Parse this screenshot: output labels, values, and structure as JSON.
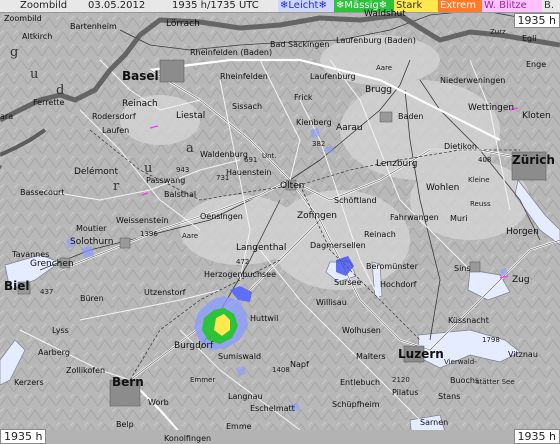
{
  "topbar": {
    "mode": "Zoombild",
    "date": "03.05.2012",
    "time": "1935 h/1735 UTC"
  },
  "legend": [
    {
      "label": "Leicht",
      "icon": "snowflake-icon",
      "glyph": "❄",
      "bg": "#cfd6ff",
      "color": "#1f2bd6"
    },
    {
      "label": "Mässig",
      "icon": "snowflake-icon",
      "glyph": "❄",
      "bg": "#2cc23a",
      "color": "#ffffff"
    },
    {
      "label": "Stark",
      "icon": "",
      "glyph": "",
      "bg": "#ffe94d",
      "color": "#333333"
    },
    {
      "label": "Extrem",
      "icon": "",
      "glyph": "",
      "bg": "#ff7a2a",
      "color": "#ffffff"
    },
    {
      "label": "W. Blitze",
      "icon": "",
      "glyph": "",
      "bg": "#ffc2ff",
      "color": "#a020a0"
    },
    {
      "label": "B.",
      "icon": "",
      "glyph": "",
      "bg": "#e8e8e8",
      "color": "#333333"
    }
  ],
  "time_boxes": {
    "top_right": "1935 h",
    "bottom_left": "1935 h",
    "bottom_right": "1935 h"
  },
  "colors": {
    "map_base": "#b9b9b9",
    "road": "#ffffff",
    "border": "#5c5c5c",
    "water": "#e8f0ff",
    "precip_light": "#8a9bff",
    "precip_moderate": "#2cc23a",
    "precip_heavy": "#ffe94d",
    "lightning": "#ff33ff"
  },
  "places": [
    {
      "name": "Zoombild"
    },
    {
      "name": "Altkirch"
    },
    {
      "name": "Bartenheim"
    },
    {
      "name": "Lörrach"
    },
    {
      "name": "Rheinfelden (Baden)"
    },
    {
      "name": "Laufenburg (Baden)"
    },
    {
      "name": "Bad Säckingen"
    },
    {
      "name": "Waldshut"
    },
    {
      "name": "Basel"
    },
    {
      "name": "Rheinfelden"
    },
    {
      "name": "Laufenburg"
    },
    {
      "name": "Frick"
    },
    {
      "name": "Brugg"
    },
    {
      "name": "Baden"
    },
    {
      "name": "Wettingen"
    },
    {
      "name": "Niederweningen"
    },
    {
      "name": "Kloten"
    },
    {
      "name": "Reinach"
    },
    {
      "name": "Rodersdorf"
    },
    {
      "name": "Ferrette"
    },
    {
      "name": "Liestal"
    },
    {
      "name": "Sissach"
    },
    {
      "name": "Kienberg"
    },
    {
      "name": "Aarau"
    },
    {
      "name": "Dietikon"
    },
    {
      "name": "Zürich"
    },
    {
      "name": "Laufen"
    },
    {
      "name": "Waldenburg"
    },
    {
      "name": "Lenzburg"
    },
    {
      "name": "Delémont"
    },
    {
      "name": "Hauenstein"
    },
    {
      "name": "Olten"
    },
    {
      "name": "Wohlen"
    },
    {
      "name": "Bassecourt"
    },
    {
      "name": "Passwang"
    },
    {
      "name": "Balsthal"
    },
    {
      "name": "Schöftland"
    },
    {
      "name": "Zofingen"
    },
    {
      "name": "Fahrwangen"
    },
    {
      "name": "Muri"
    },
    {
      "name": "Oensingen"
    },
    {
      "name": "Weissenstein"
    },
    {
      "name": "Moutier"
    },
    {
      "name": "Reinach"
    },
    {
      "name": "Horgen"
    },
    {
      "name": "Solothurn"
    },
    {
      "name": "Langenthal"
    },
    {
      "name": "Dagmersellen"
    },
    {
      "name": "Beromünster"
    },
    {
      "name": "Tavannes"
    },
    {
      "name": "Grenchen"
    },
    {
      "name": "Hochdorf"
    },
    {
      "name": "Sins"
    },
    {
      "name": "Herzogenbuchsee"
    },
    {
      "name": "Sursee"
    },
    {
      "name": "Zug"
    },
    {
      "name": "Biel"
    },
    {
      "name": "Utzenstorf"
    },
    {
      "name": "Willisau"
    },
    {
      "name": "Büren"
    },
    {
      "name": "Huttwil"
    },
    {
      "name": "Küssnacht"
    },
    {
      "name": "Lyss"
    },
    {
      "name": "Wolhusen"
    },
    {
      "name": "Aarberg"
    },
    {
      "name": "Burgdorf"
    },
    {
      "name": "Sumiswald"
    },
    {
      "name": "Malters"
    },
    {
      "name": "Luzern"
    },
    {
      "name": "Vitznau"
    },
    {
      "name": "Zollikofen"
    },
    {
      "name": "Kerzers"
    },
    {
      "name": "Bern"
    },
    {
      "name": "Napf"
    },
    {
      "name": "Entlebuch"
    },
    {
      "name": "Buochs"
    },
    {
      "name": "Stans"
    },
    {
      "name": "Worb"
    },
    {
      "name": "Langnau"
    },
    {
      "name": "Schüpfheim"
    },
    {
      "name": "Pilatus"
    },
    {
      "name": "Eschelmatt"
    },
    {
      "name": "Sarnen"
    },
    {
      "name": "Konolfingen"
    },
    {
      "name": "Belp"
    },
    {
      "name": "Unt."
    },
    {
      "name": "Vierwald-"
    },
    {
      "name": "stätter See"
    },
    {
      "name": "Egli"
    },
    {
      "name": "Zurz."
    },
    {
      "name": "Enge"
    },
    {
      "name": "ara"
    },
    {
      "name": "Emme"
    },
    {
      "name": "a"
    },
    {
      "name": "u"
    },
    {
      "name": "r"
    },
    {
      "name": "d"
    },
    {
      "name": "g"
    },
    {
      "name": "u"
    },
    {
      "name": "Aare"
    },
    {
      "name": "Reuss"
    },
    {
      "name": "Kleine"
    },
    {
      "name": "Aare"
    },
    {
      "name": "Emmer"
    },
    {
      "name": "1396"
    },
    {
      "name": "943"
    },
    {
      "name": "731"
    },
    {
      "name": "691"
    },
    {
      "name": "382"
    },
    {
      "name": "472"
    },
    {
      "name": "437"
    },
    {
      "name": "1408"
    },
    {
      "name": "2120"
    },
    {
      "name": "1798"
    },
    {
      "name": "408"
    }
  ]
}
